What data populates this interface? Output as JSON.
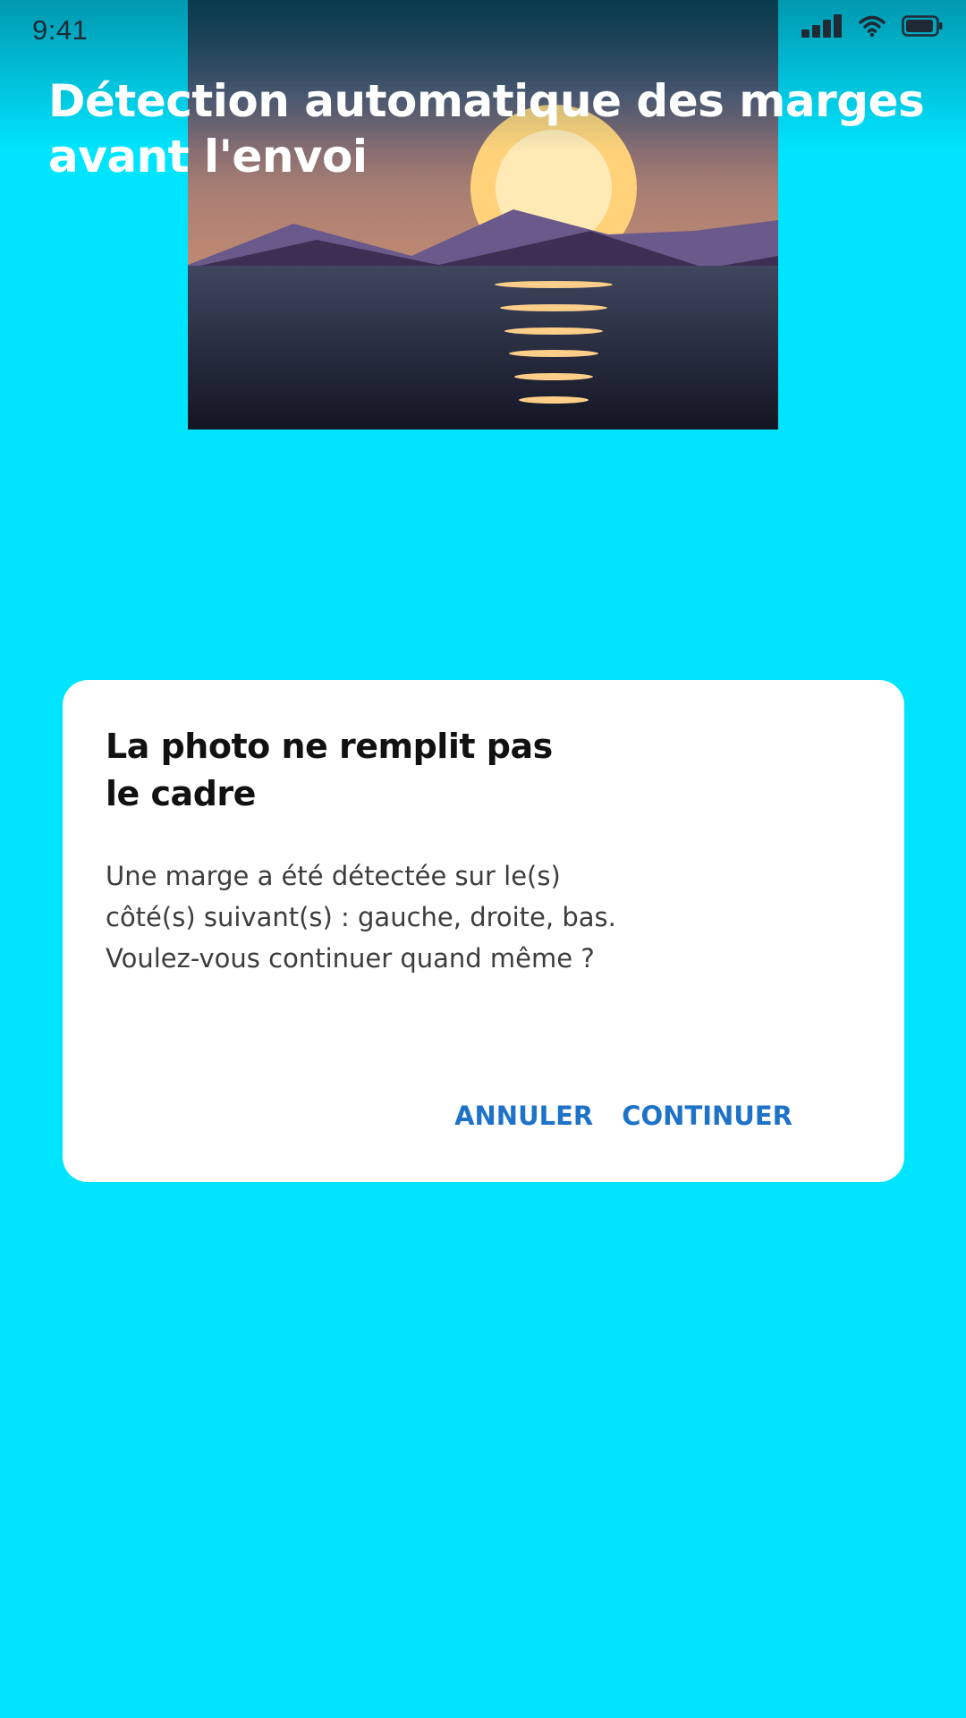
{
  "status_bar": {
    "time": "9:41",
    "icons": [
      "signal-icon",
      "wifi-icon",
      "battery-icon"
    ]
  },
  "screen": {
    "title": "Détection automatique des marges avant l'envoi",
    "background_color": "#00e5ff"
  },
  "photo": {
    "subject": "sunset-over-lake-image"
  },
  "dialog": {
    "title": "La photo ne remplit pas\nle cadre",
    "title_line1": "La photo ne remplit pas",
    "title_line2": "le cadre",
    "message_line1": "Une marge a été détectée sur le(s)",
    "message_line2": "côté(s) suivant(s) : gauche, droite, bas.",
    "message_line3": "Voulez-vous continuer quand même ?",
    "cancel_label": "ANNULER",
    "continue_label": "CONTINUER",
    "accent_color": "#1e73c8"
  }
}
